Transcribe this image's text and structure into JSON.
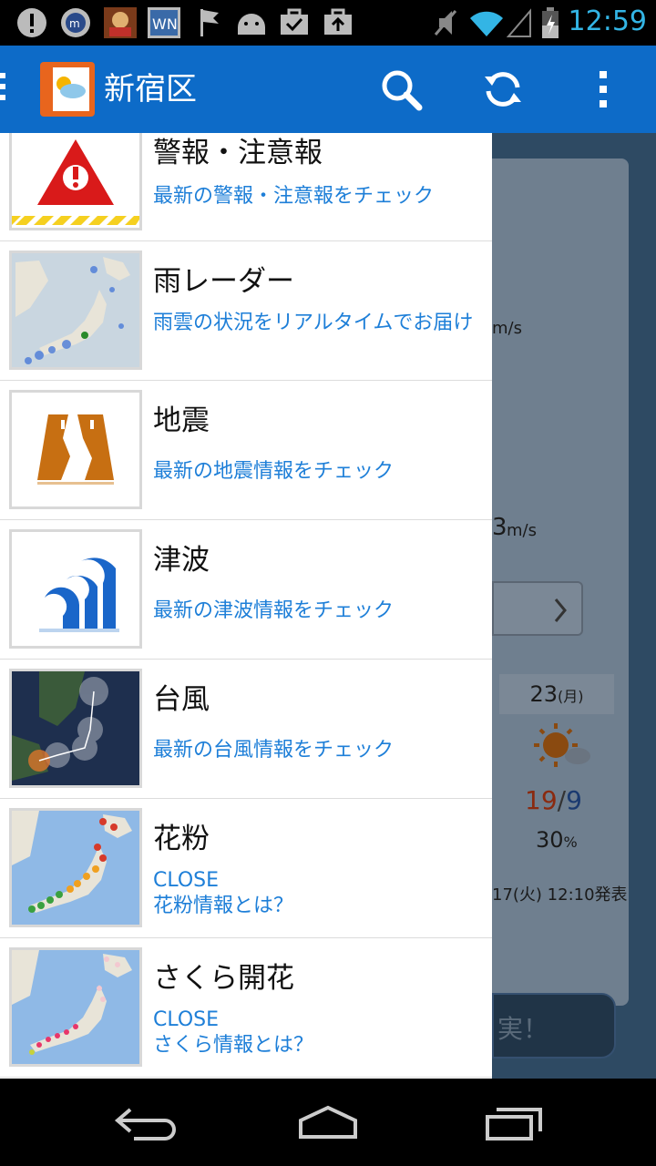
{
  "status_bar": {
    "time": "12:59",
    "icons": [
      "alert-icon",
      "mobile-app-icon",
      "game-icon",
      "news-icon",
      "flag-icon",
      "android-icon",
      "briefcase-check-icon",
      "briefcase-upload-icon",
      "mute-icon",
      "wifi-icon",
      "signal-icon",
      "battery-icon"
    ]
  },
  "action_bar": {
    "title": "新宿区",
    "icons": [
      "search-icon",
      "refresh-icon",
      "overflow-menu-icon"
    ]
  },
  "drawer": {
    "items": [
      {
        "title": "警報・注意報",
        "subtitle": "最新の警報・注意報をチェック",
        "icon": "warning-icon"
      },
      {
        "title": "雨レーダー",
        "subtitle": "雨雲の状況をリアルタイムでお届け",
        "icon": "rain-radar-map-icon"
      },
      {
        "title": "地震",
        "subtitle": "最新の地震情報をチェック",
        "icon": "earthquake-icon"
      },
      {
        "title": "津波",
        "subtitle": "最新の津波情報をチェック",
        "icon": "tsunami-icon"
      },
      {
        "title": "台風",
        "subtitle": "最新の台風情報をチェック",
        "icon": "typhoon-map-icon"
      },
      {
        "title": "花粉",
        "subtitle_line1": "CLOSE",
        "subtitle_line2": "花粉情報とは？",
        "icon": "pollen-map-icon"
      },
      {
        "title": "さくら開花",
        "subtitle_line1": "CLOSE",
        "subtitle_line2": "さくら情報とは？",
        "icon": "sakura-map-icon"
      }
    ]
  },
  "background": {
    "wind1": "m/s",
    "wind2_value": "3",
    "wind2_unit": "m/s",
    "day_label": "23",
    "day_weekday": "(月)",
    "temp_high": "19",
    "temp_sep": "/",
    "temp_low": "9",
    "precip": "30",
    "precip_unit": "%",
    "issued": "17(火) 12:10発表",
    "button_text": "実！"
  },
  "nav_bar": {
    "icons": [
      "back-icon",
      "home-icon",
      "recent-apps-icon"
    ]
  },
  "colors": {
    "action_bar": "#0d6bc8",
    "subtitle_blue": "#1e7fd8",
    "status_time": "#33b5e5"
  }
}
